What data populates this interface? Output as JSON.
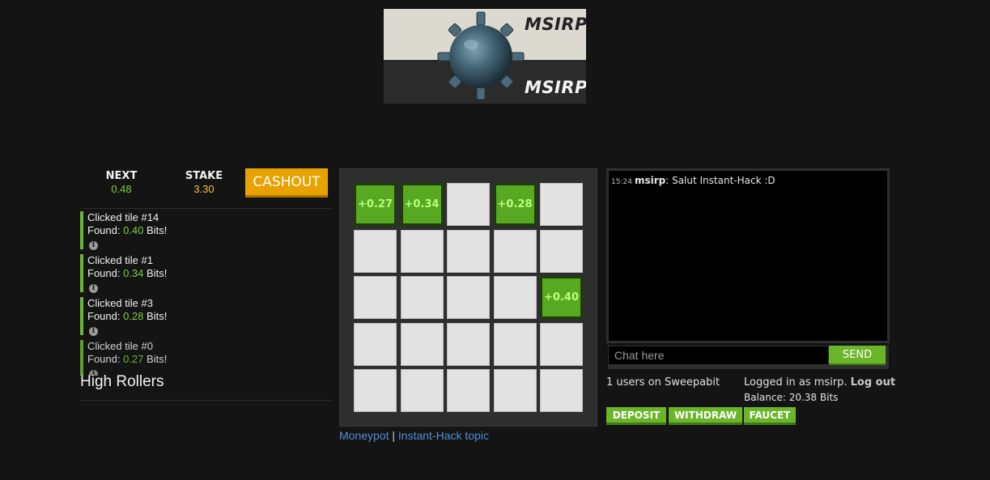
{
  "logo": {
    "text_top": "MSIRP",
    "text_bottom": "MSIRP"
  },
  "stats": {
    "next_label": "NEXT",
    "next_value": "0.48",
    "stake_label": "STAKE",
    "stake_value": "3.30",
    "cashout_label": "CASHOUT"
  },
  "log": [
    {
      "title": "Clicked tile #14",
      "found_prefix": "Found: ",
      "amount": "0.40",
      "found_suffix": " Bits!"
    },
    {
      "title": "Clicked tile #1",
      "found_prefix": "Found: ",
      "amount": "0.34",
      "found_suffix": " Bits!"
    },
    {
      "title": "Clicked tile #3",
      "found_prefix": "Found: ",
      "amount": "0.28",
      "found_suffix": " Bits!"
    },
    {
      "title": "Clicked tile #0",
      "found_prefix": "Found: ",
      "amount": "0.27",
      "found_suffix": " Bits!"
    }
  ],
  "high_rollers_title": "High Rollers",
  "board": {
    "tiles": [
      "+0.27",
      "+0.34",
      "",
      "+0.28",
      "",
      "",
      "",
      "",
      "",
      "",
      "",
      "",
      "",
      "",
      "+0.40",
      "",
      "",
      "",
      "",
      "",
      "",
      "",
      "",
      "",
      ""
    ]
  },
  "links": {
    "moneypot": "Moneypot",
    "separator": " | ",
    "topic": "Instant-Hack topic"
  },
  "chat": {
    "messages": [
      {
        "time": "15:24",
        "user": "msirp",
        "text": ": Salut Instant-Hack :D"
      }
    ],
    "placeholder": "Chat here",
    "send_label": "SEND",
    "users_online": "1 users on Sweepabit"
  },
  "account": {
    "logged_in_prefix": "Logged in as msirp. ",
    "logout_label": "Log out",
    "balance": "Balance: 20.38 Bits",
    "deposit_label": "DEPOSIT",
    "withdraw_label": "WITHDRAW",
    "faucet_label": "FAUCET"
  },
  "colors": {
    "accent_green": "#6bb52a",
    "cashout_orange": "#e8a200",
    "link_blue": "#4d8fd6"
  }
}
